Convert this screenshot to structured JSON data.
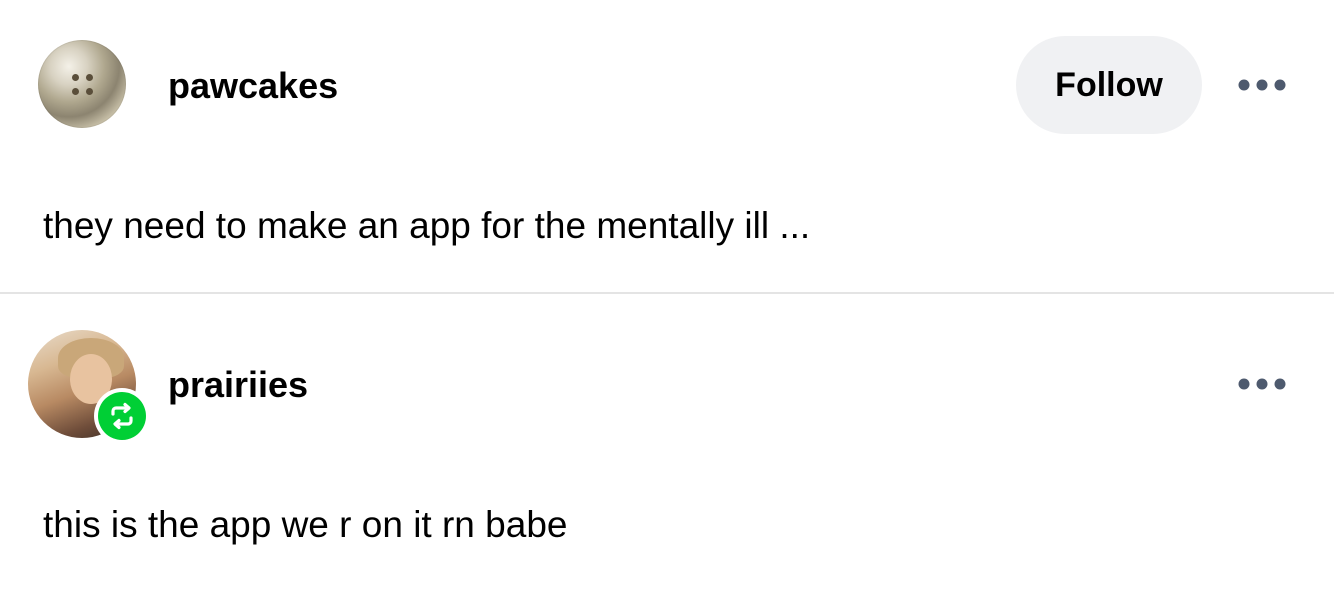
{
  "posts": [
    {
      "username": "pawcakes",
      "follow_label": "Follow",
      "more_icon": "ellipsis-icon",
      "body": "they need to make an app for the mentally ill ...",
      "avatar_icon": "button-avatar"
    },
    {
      "username": "prairiies",
      "more_icon": "ellipsis-icon",
      "body": "this is the app we r on it rn babe",
      "avatar_icon": "person-avatar",
      "badge_icon": "reblog-icon"
    }
  ],
  "colors": {
    "follow_bg": "#f0f1f3",
    "more_dots": "#4e5a6e",
    "reblog_green": "#00cf35",
    "divider": "#e4e4e4",
    "text": "#000000"
  }
}
